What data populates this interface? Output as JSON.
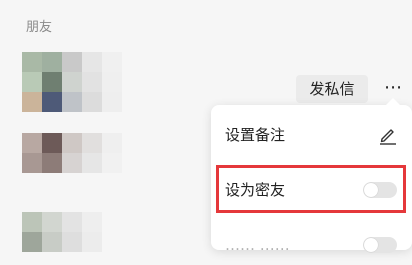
{
  "section": {
    "title": "朋友"
  },
  "friend_row": {
    "message_button": "发私信",
    "more_icon": "more-horizontal-icon"
  },
  "menu": {
    "remark_label": "设置备注",
    "remark_icon": "edit-pencil-icon",
    "close_friend_label": "设为密友",
    "close_friend_toggle_on": false,
    "third_item_label": "…… ……",
    "highlight_color": "#e5383b"
  },
  "avatars": [
    {
      "name": "friend-1-avatar",
      "colors": [
        "#a9b9a6",
        "#9fb0a0",
        "#c9c9c9",
        "#e6e6e6",
        "#f0f0f0",
        "#b9cab6",
        "#6f7f71",
        "#cfd3cf",
        "#e2e2e2",
        "#efefef",
        "#cbb49a",
        "#4e5a78",
        "#bfc3c8",
        "#dcdcdc",
        "#eeeeee"
      ]
    },
    {
      "name": "friend-2-avatar",
      "colors": [
        "#b8a8a2",
        "#6d5a58",
        "#cfc8c5",
        "#e1dfde",
        "#efefef",
        "#a89893",
        "#8d7c78",
        "#d7d3d2",
        "#e6e6e6",
        "#f1f1f1"
      ]
    },
    {
      "name": "friend-3-avatar",
      "colors": [
        "#bcc5b8",
        "#d2d6d0",
        "#e3e3e3",
        "#eeeeee",
        "#9ea69b",
        "#c8ccc6",
        "#dedede",
        "#ececec"
      ]
    }
  ]
}
